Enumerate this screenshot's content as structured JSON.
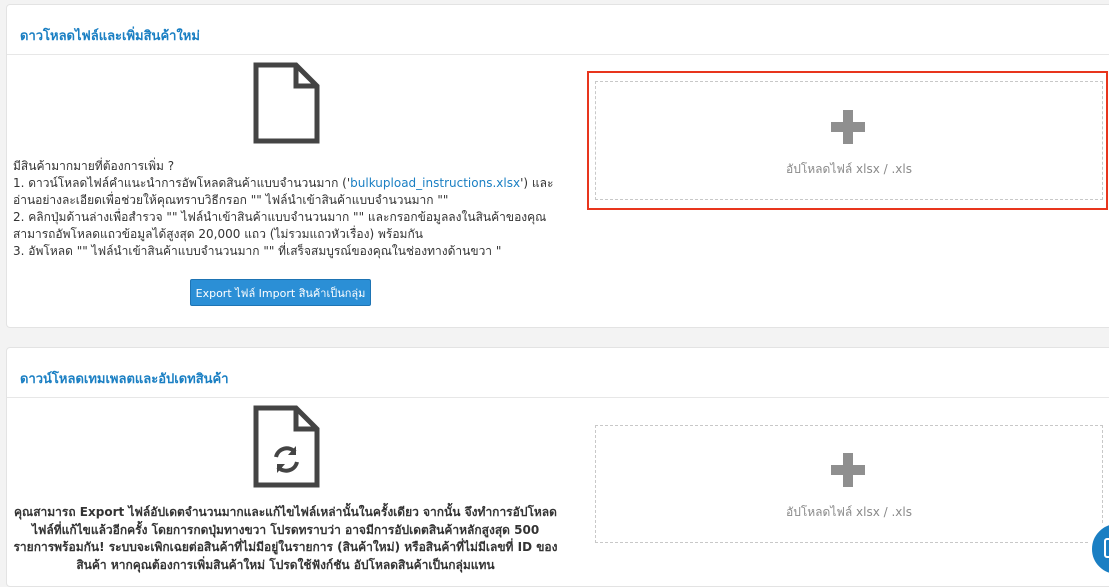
{
  "section_upload": {
    "title": "ดาวโหลดไฟล์และเพิ่มสินค้าใหม่",
    "instructions": [
      "มีสินค้ามากมายที่ต้องการเพิ่ม ?",
      "1. ดาวน์โหลดไฟล์คำแนะนำการอัพโหลดสินค้าแบบจำนวนมาก ('",
      "bulkupload_instructions.xlsx",
      "') และ",
      "อ่านอย่างละเอียดเพื่อช่วยให้คุณทราบวิธีกรอก \"\" ไฟล์นำเข้าสินค้าแบบจำนวนมาก \"\"",
      "2. คลิกปุ่มด้านล่างเพื่อสำรวจ \"\" ไฟล์นำเข้าสินค้าแบบจำนวนมาก \"\" และกรอกข้อมูลลงในสินค้าของคุณ",
      "สามารถอัพโหลดแถวข้อมูลได้สูงสุด 20,000 แถว (ไม่รวมแถวหัวเรื่อง) พร้อมกัน",
      "3. อัพโหลด \"\" ไฟล์นำเข้าสินค้าแบบจำนวนมาก \"\" ที่เสร็จสมบูรณ์ของคุณในช่องทางด้านขวา \""
    ],
    "export_button": "Export ไฟล์ Import สินค้าเป็นกลุ่ม",
    "upload_label": "อัปโหลดไฟล์ xlsx / .xls",
    "highlight_color": "#e8351d"
  },
  "section_update": {
    "title": "ดาวน์โหลดเทมเพลตและอัปเดทสินค้า",
    "description": [
      "คุณสามารถ Export ไฟล์อัปเดตจำนวนมากและแก้ไขไฟล์เหล่านั้นในครั้งเดียว จากนั้น จึงทำการอัปโหลด",
      "ไฟล์ที่แก้ไขแล้วอีกครั้ง โดยการกดปุ่มทางขวา โปรดทราบว่า อาจมีการอัปเดตสินค้าหลักสูงสุด 500",
      "รายการพร้อมกัน! ระบบจะเพิกเฉยต่อสินค้าที่ไม่มีอยู่ในรายการ (สินค้าใหม่) หรือสินค้าที่ไม่มีเลขที่ ID ของ",
      "สินค้า หากคุณต้องการเพิ่มสินค้าใหม่ โปรดใช้ฟังก์ชัน อัปโหลดสินค้าเป็นกลุ่มแทน"
    ],
    "upload_label": "อัปโหลดไฟล์ xlsx / .xls"
  },
  "icons": {
    "file": "document-icon",
    "refresh_file": "file-refresh-icon",
    "plus": "plus-icon",
    "chat": "chat-icon"
  },
  "colors": {
    "accent": "#1a7fc3",
    "button": "#2b8fd6"
  }
}
